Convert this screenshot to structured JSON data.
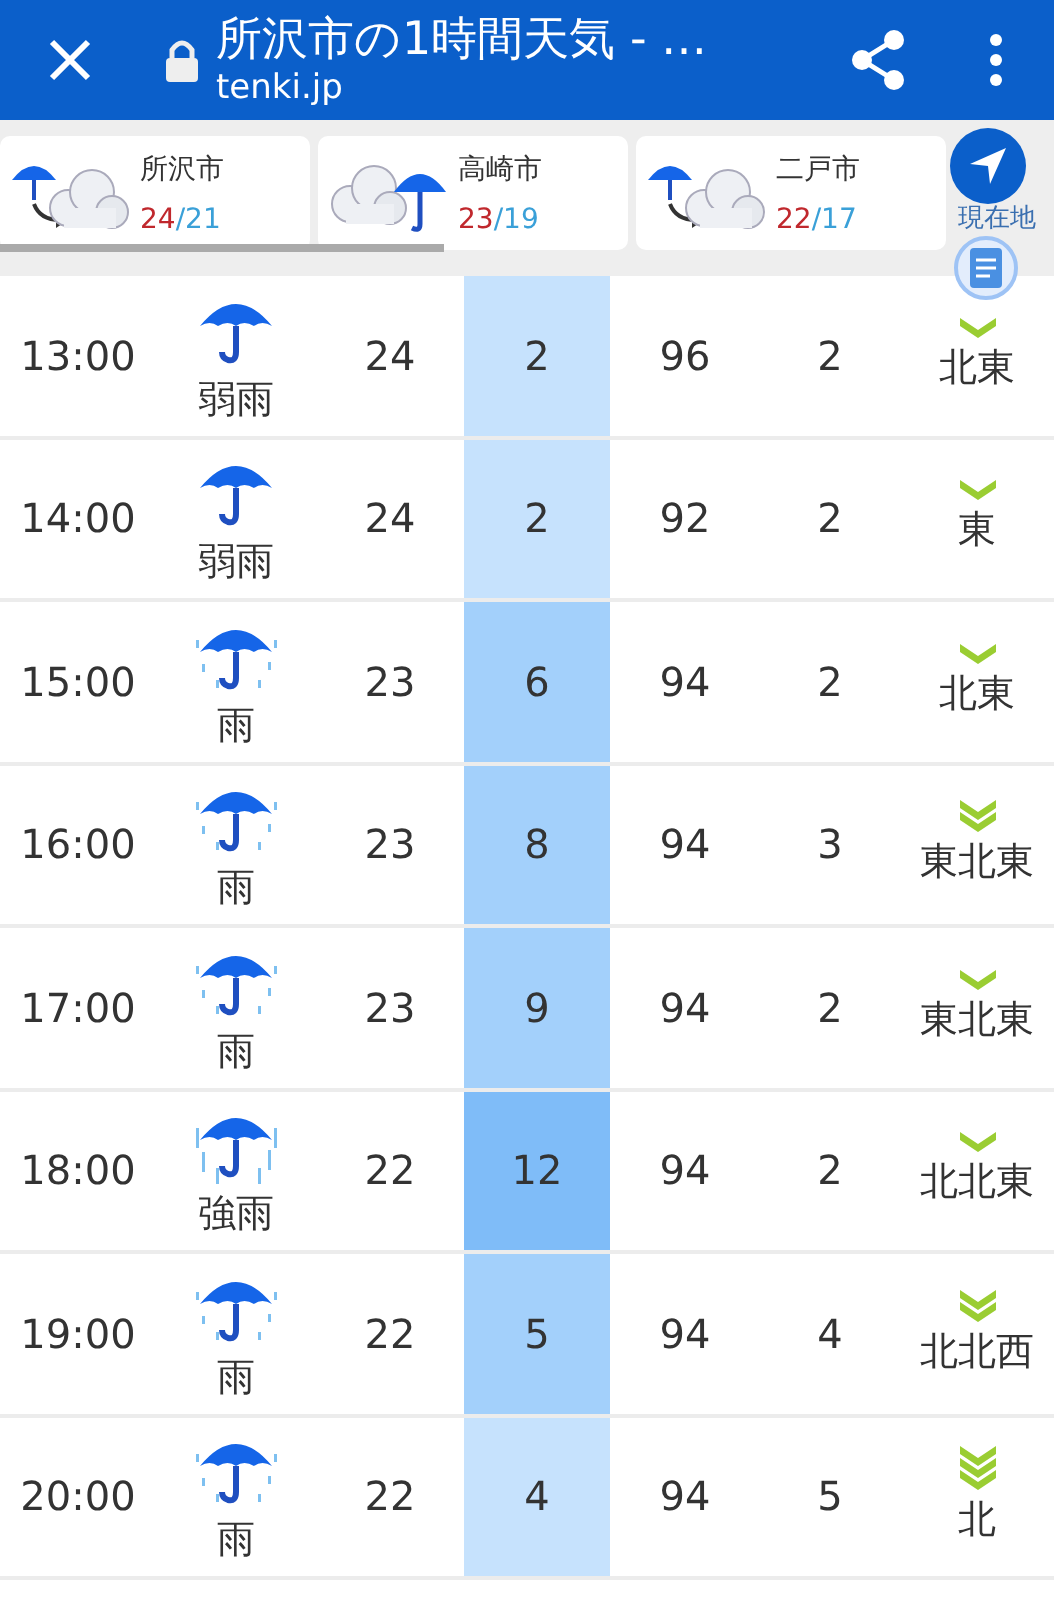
{
  "toolbar": {
    "title": "所沢市の1時間天気 - …",
    "url": "tenki.jp"
  },
  "locations": [
    {
      "name": "所沢市",
      "high": "24",
      "separator": "/",
      "low": "21",
      "kind": "rain-to-cloud"
    },
    {
      "name": "高崎市",
      "high": "23",
      "separator": "/",
      "low": "19",
      "kind": "cloud-and-rain"
    },
    {
      "name": "二戸市",
      "high": "22",
      "separator": "/",
      "low": "17",
      "kind": "rain-to-cloud"
    }
  ],
  "current_location": {
    "label": "現在地"
  },
  "rows": [
    {
      "time": "13:00",
      "kind": "light-rain",
      "weather": "弱雨",
      "temp": "24",
      "precip": "2",
      "color": "#c6e2fd",
      "humidity": "96",
      "wind": "2",
      "wind_arrow": {
        "kind": "single"
      },
      "direction": "北東"
    },
    {
      "time": "14:00",
      "kind": "light-rain",
      "weather": "弱雨",
      "temp": "24",
      "precip": "2",
      "color": "#c6e2fd",
      "humidity": "92",
      "wind": "2",
      "wind_arrow": {
        "kind": "single"
      },
      "direction": "東"
    },
    {
      "time": "15:00",
      "kind": "rain",
      "weather": "雨",
      "temp": "23",
      "precip": "6",
      "color": "#a3d0fb",
      "humidity": "94",
      "wind": "2",
      "wind_arrow": {
        "kind": "single"
      },
      "direction": "北東"
    },
    {
      "time": "16:00",
      "kind": "rain",
      "weather": "雨",
      "temp": "23",
      "precip": "8",
      "color": "#a3d0fb",
      "humidity": "94",
      "wind": "3",
      "wind_arrow": {
        "kind": "double"
      },
      "direction": "東北東"
    },
    {
      "time": "17:00",
      "kind": "rain",
      "weather": "雨",
      "temp": "23",
      "precip": "9",
      "color": "#a3d0fb",
      "humidity": "94",
      "wind": "2",
      "wind_arrow": {
        "kind": "single"
      },
      "direction": "東北東"
    },
    {
      "time": "18:00",
      "kind": "heavy-rain",
      "weather": "強雨",
      "temp": "22",
      "precip": "12",
      "color": "#7fbcf8",
      "humidity": "94",
      "wind": "2",
      "wind_arrow": {
        "kind": "single"
      },
      "direction": "北北東"
    },
    {
      "time": "19:00",
      "kind": "rain",
      "weather": "雨",
      "temp": "22",
      "precip": "5",
      "color": "#a3d0fb",
      "humidity": "94",
      "wind": "4",
      "wind_arrow": {
        "kind": "double"
      },
      "direction": "北北西"
    },
    {
      "time": "20:00",
      "kind": "rain",
      "weather": "雨",
      "temp": "22",
      "precip": "4",
      "color": "#c6e2fd",
      "humidity": "94",
      "wind": "5",
      "wind_arrow": {
        "kind": "triple"
      },
      "direction": "北"
    }
  ]
}
